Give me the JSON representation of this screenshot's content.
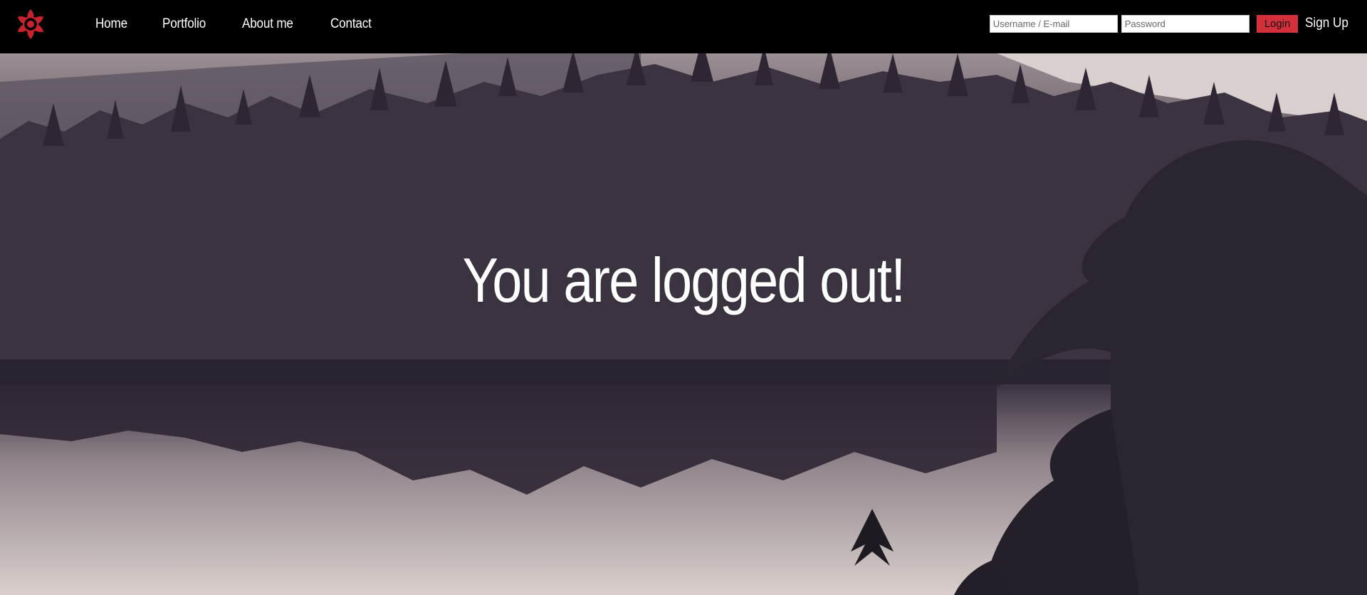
{
  "nav": {
    "links": [
      "Home",
      "Portfolio",
      "About me",
      "Contact"
    ],
    "logo_icon": "red-flower-logo-icon",
    "accent_color": "#d3303c"
  },
  "auth": {
    "username_placeholder": "Username / E-mail",
    "password_placeholder": "Password",
    "login_label": "Login",
    "signup_label": "Sign Up"
  },
  "hero": {
    "headline": "You are logged out!"
  }
}
